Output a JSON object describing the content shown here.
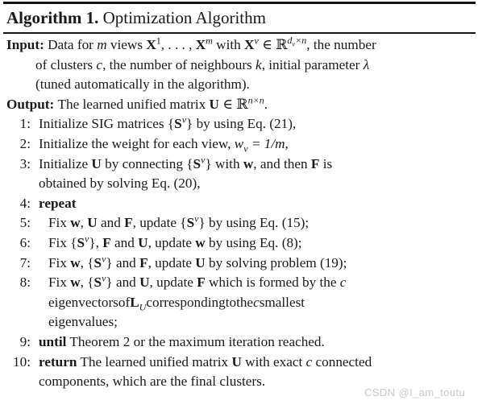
{
  "title": {
    "label": "Algorithm 1.",
    "name": "Optimization Algorithm"
  },
  "io": {
    "input_label": "Input:",
    "input_line1_a": "Data for ",
    "input_m": "m",
    "input_line1_b": " views ",
    "input_X": "X",
    "input_sup1": "1",
    "input_commas": ", . . . , ",
    "input_Xm": "X",
    "input_supm": "m",
    "input_with": " with ",
    "input_Xv": "X",
    "input_supv": "v",
    "input_in": " ∈ ",
    "input_R": "ℝ",
    "input_Rsup_d": "d",
    "input_Rsub_v": "v",
    "input_Rsup_times_n": "×n",
    "input_tail": ", the number",
    "input_line2_a": "of clusters ",
    "input_c": "c",
    "input_line2_b": ", the number of neighbours ",
    "input_k": "k",
    "input_line2_c": ", initial parameter ",
    "input_lambda": "λ",
    "input_line3": "(tuned automatically in the algorithm).",
    "output_label": "Output:",
    "output_line_a": "The learned unified matrix ",
    "output_U": "U",
    "output_in": " ∈ ",
    "output_R": "ℝ",
    "output_Rsup": "n×n",
    "output_period": "."
  },
  "steps": [
    {
      "num": "1:",
      "indent": false,
      "lines": [
        {
          "parts": [
            {
              "t": "Initialize SIG matrices {",
              "s": "plain"
            },
            {
              "t": "S",
              "s": "mbf"
            },
            {
              "t": "v",
              "s": "sup-it"
            },
            {
              "t": "} by using Eq. (21),",
              "s": "plain"
            }
          ]
        }
      ]
    },
    {
      "num": "2:",
      "indent": false,
      "lines": [
        {
          "parts": [
            {
              "t": "Initialize the weight for each view, ",
              "s": "plain"
            },
            {
              "t": "w",
              "s": "mit"
            },
            {
              "t": "v",
              "s": "sub-it"
            },
            {
              "t": " = 1/",
              "s": "mit"
            },
            {
              "t": "m",
              "s": "mit"
            },
            {
              "t": ",",
              "s": "plain"
            }
          ]
        }
      ]
    },
    {
      "num": "3:",
      "indent": false,
      "lines": [
        {
          "parts": [
            {
              "t": "Initialize ",
              "s": "plain"
            },
            {
              "t": "U",
              "s": "mbf"
            },
            {
              "t": " by connecting {",
              "s": "plain"
            },
            {
              "t": "S",
              "s": "mbf"
            },
            {
              "t": "v",
              "s": "sup-it"
            },
            {
              "t": "} with ",
              "s": "plain"
            },
            {
              "t": "w",
              "s": "mbf"
            },
            {
              "t": ", and then ",
              "s": "plain"
            },
            {
              "t": "F",
              "s": "mbf"
            },
            {
              "t": " is",
              "s": "plain"
            }
          ]
        },
        {
          "parts": [
            {
              "t": "obtained by solving Eq. (20),",
              "s": "plain"
            }
          ]
        }
      ]
    },
    {
      "num": "4:",
      "indent": false,
      "lines": [
        {
          "parts": [
            {
              "t": "repeat",
              "s": "kw"
            }
          ]
        }
      ]
    },
    {
      "num": "5:",
      "indent": true,
      "lines": [
        {
          "parts": [
            {
              "t": "Fix ",
              "s": "plain"
            },
            {
              "t": "w",
              "s": "mbf"
            },
            {
              "t": ", ",
              "s": "plain"
            },
            {
              "t": "U",
              "s": "mbf"
            },
            {
              "t": " and ",
              "s": "plain"
            },
            {
              "t": "F",
              "s": "mbf"
            },
            {
              "t": ", update {",
              "s": "plain"
            },
            {
              "t": "S",
              "s": "mbf"
            },
            {
              "t": "v",
              "s": "sup-it"
            },
            {
              "t": "} by using Eq. (15);",
              "s": "plain"
            }
          ]
        }
      ]
    },
    {
      "num": "6:",
      "indent": true,
      "lines": [
        {
          "parts": [
            {
              "t": "Fix {",
              "s": "plain"
            },
            {
              "t": "S",
              "s": "mbf"
            },
            {
              "t": "v",
              "s": "sup-it"
            },
            {
              "t": "}, ",
              "s": "plain"
            },
            {
              "t": "F",
              "s": "mbf"
            },
            {
              "t": " and ",
              "s": "plain"
            },
            {
              "t": "U",
              "s": "mbf"
            },
            {
              "t": ", update ",
              "s": "plain"
            },
            {
              "t": "w",
              "s": "mbf"
            },
            {
              "t": " by using Eq. (8);",
              "s": "plain"
            }
          ]
        }
      ]
    },
    {
      "num": "7:",
      "indent": true,
      "lines": [
        {
          "parts": [
            {
              "t": "Fix ",
              "s": "plain"
            },
            {
              "t": "w",
              "s": "mbf"
            },
            {
              "t": ", {",
              "s": "plain"
            },
            {
              "t": "S",
              "s": "mbf"
            },
            {
              "t": "v",
              "s": "sup-it"
            },
            {
              "t": "} and ",
              "s": "plain"
            },
            {
              "t": "F",
              "s": "mbf"
            },
            {
              "t": ", update ",
              "s": "plain"
            },
            {
              "t": "U",
              "s": "mbf"
            },
            {
              "t": " by solving problem (19);",
              "s": "plain"
            }
          ]
        }
      ]
    },
    {
      "num": "8:",
      "indent": true,
      "lines": [
        {
          "parts": [
            {
              "t": "Fix ",
              "s": "plain"
            },
            {
              "t": "w",
              "s": "mbf"
            },
            {
              "t": ", {",
              "s": "plain"
            },
            {
              "t": "S",
              "s": "mbf"
            },
            {
              "t": "v",
              "s": "sup-it"
            },
            {
              "t": "} and ",
              "s": "plain"
            },
            {
              "t": "U",
              "s": "mbf"
            },
            {
              "t": ", update ",
              "s": "plain"
            },
            {
              "t": "F",
              "s": "mbf"
            },
            {
              "t": " which is formed by the ",
              "s": "plain"
            },
            {
              "t": "c",
              "s": "mit"
            }
          ]
        },
        {
          "justified": true,
          "words": [
            {
              "parts": [
                {
                  "t": "eigenvectors",
                  "s": "plain"
                }
              ]
            },
            {
              "parts": [
                {
                  "t": "of",
                  "s": "plain"
                }
              ]
            },
            {
              "parts": [
                {
                  "t": "L",
                  "s": "mbf"
                },
                {
                  "t": "U",
                  "s": "sub-it"
                }
              ]
            },
            {
              "parts": [
                {
                  "t": "corresponding",
                  "s": "plain"
                }
              ]
            },
            {
              "parts": [
                {
                  "t": "to",
                  "s": "plain"
                }
              ]
            },
            {
              "parts": [
                {
                  "t": "the",
                  "s": "plain"
                }
              ]
            },
            {
              "parts": [
                {
                  "t": "c",
                  "s": "mit"
                }
              ]
            },
            {
              "parts": [
                {
                  "t": "smallest",
                  "s": "plain"
                }
              ]
            }
          ]
        },
        {
          "parts": [
            {
              "t": "eigenvalues;",
              "s": "plain"
            }
          ]
        }
      ]
    },
    {
      "num": "9:",
      "indent": false,
      "lines": [
        {
          "parts": [
            {
              "t": "until",
              "s": "kw"
            },
            {
              "t": " Theorem 2 or the maximum iteration reached.",
              "s": "plain"
            }
          ]
        }
      ]
    },
    {
      "num": "10:",
      "indent": false,
      "lines": [
        {
          "parts": [
            {
              "t": "return",
              "s": "kw"
            },
            {
              "t": " The learned unified matrix ",
              "s": "plain"
            },
            {
              "t": "U",
              "s": "mbf"
            },
            {
              "t": " with exact ",
              "s": "plain"
            },
            {
              "t": "c",
              "s": "mit"
            },
            {
              "t": " connected",
              "s": "plain"
            }
          ]
        },
        {
          "parts": [
            {
              "t": "components, which are the final clusters.",
              "s": "plain"
            }
          ]
        }
      ]
    }
  ],
  "watermark": "CSDN @I_am_toutu"
}
